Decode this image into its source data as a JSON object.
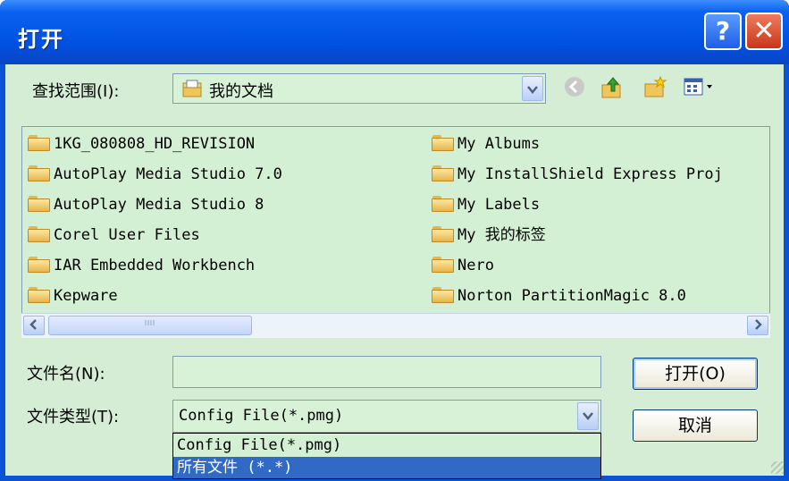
{
  "window": {
    "title": "打开",
    "help_label": "?",
    "close_label": "✕"
  },
  "lookin": {
    "label": "查找范围(I):",
    "value": "我的文档"
  },
  "toolbar": {
    "icons": [
      "back-icon",
      "up-folder-icon",
      "new-folder-icon",
      "view-menu-icon"
    ]
  },
  "files": {
    "left": [
      "1KG_080808_HD_REVISION",
      "AutoPlay Media Studio 7.0",
      "AutoPlay Media Studio 8",
      "Corel User Files",
      "IAR Embedded Workbench",
      "Kepware"
    ],
    "right": [
      "My Albums",
      "My InstallShield Express Proj",
      "My Labels",
      "My 我的标签",
      "Nero",
      "Norton PartitionMagic 8.0"
    ]
  },
  "filename": {
    "label": "文件名(N):",
    "value": ""
  },
  "filetype": {
    "label": "文件类型(T):",
    "value": "Config File(*.pmg)",
    "options": [
      "Config File(*.pmg)",
      "所有文件 (*.*)"
    ]
  },
  "buttons": {
    "open": "打开(O)",
    "cancel": "取消"
  },
  "colors": {
    "titlebar": "#0050e0",
    "client": "#d4edd4",
    "selection": "#316ac5"
  }
}
